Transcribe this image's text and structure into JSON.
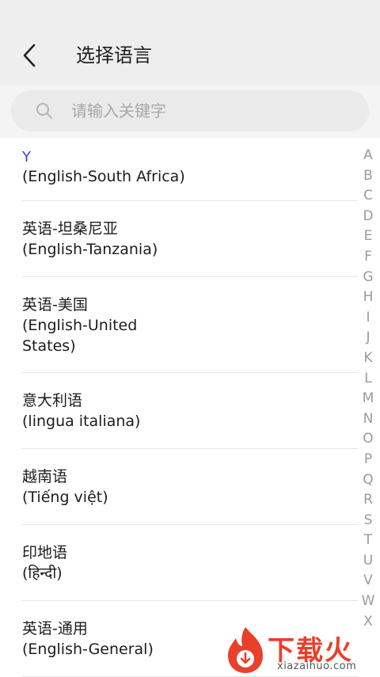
{
  "header": {
    "title": "选择语言",
    "back_icon": "chevron-left-icon"
  },
  "search": {
    "placeholder": "请输入关键字",
    "value": "",
    "icon": "search-icon"
  },
  "list": {
    "section_letter": "Y",
    "items": [
      {
        "lines": [
          "(English-South Africa)"
        ]
      },
      {
        "lines": [
          "英语-坦桑尼亚",
          "(English-Tanzania)"
        ]
      },
      {
        "lines": [
          "英语-美国",
          "(English-United",
          "States)"
        ]
      },
      {
        "lines": [
          "意大利语",
          "(lingua italiana)"
        ]
      },
      {
        "lines": [
          "越南语",
          "(Tiếng việt)"
        ]
      },
      {
        "lines": [
          "印地语",
          "(हिन्दी)"
        ]
      },
      {
        "lines": [
          "英语-通用",
          "(English-General)"
        ]
      }
    ]
  },
  "index_letters": [
    "A",
    "B",
    "C",
    "D",
    "E",
    "F",
    "G",
    "H",
    "I",
    "J",
    "K",
    "L",
    "M",
    "N",
    "O",
    "P",
    "Q",
    "R",
    "S",
    "T",
    "U",
    "V",
    "W",
    "X"
  ],
  "watermark": {
    "brand": "下载火",
    "url": "xiazaihuo.com"
  },
  "colors": {
    "accent": "#3c46d8",
    "watermark": "#e8402b"
  }
}
